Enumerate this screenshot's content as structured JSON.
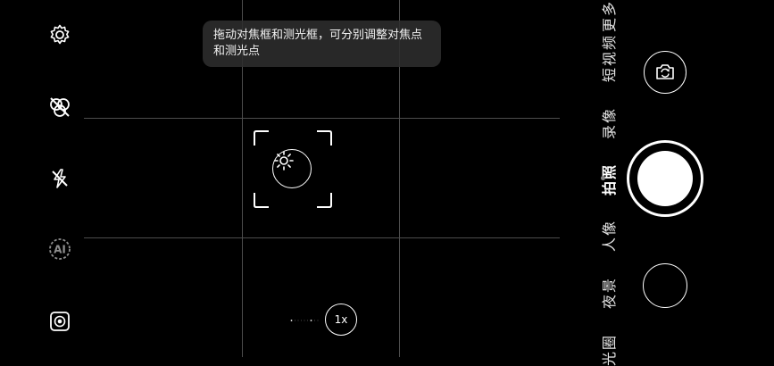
{
  "left_rail": {
    "icons": [
      "settings-icon",
      "ai-filter-icon",
      "flash-off-icon",
      "ai-mode-icon",
      "live-photo-icon"
    ],
    "ai_label": "AI"
  },
  "viewfinder": {
    "hint_text": "拖动对焦框和测光框，可分别调整对焦点和测光点",
    "zoom_label": "1x"
  },
  "modes": [
    {
      "label": "更多"
    },
    {
      "label": "短视频"
    },
    {
      "label": "录像"
    },
    {
      "label": "拍照",
      "active": true
    },
    {
      "label": "人像"
    },
    {
      "label": "夜景"
    },
    {
      "label": "光圈"
    }
  ]
}
